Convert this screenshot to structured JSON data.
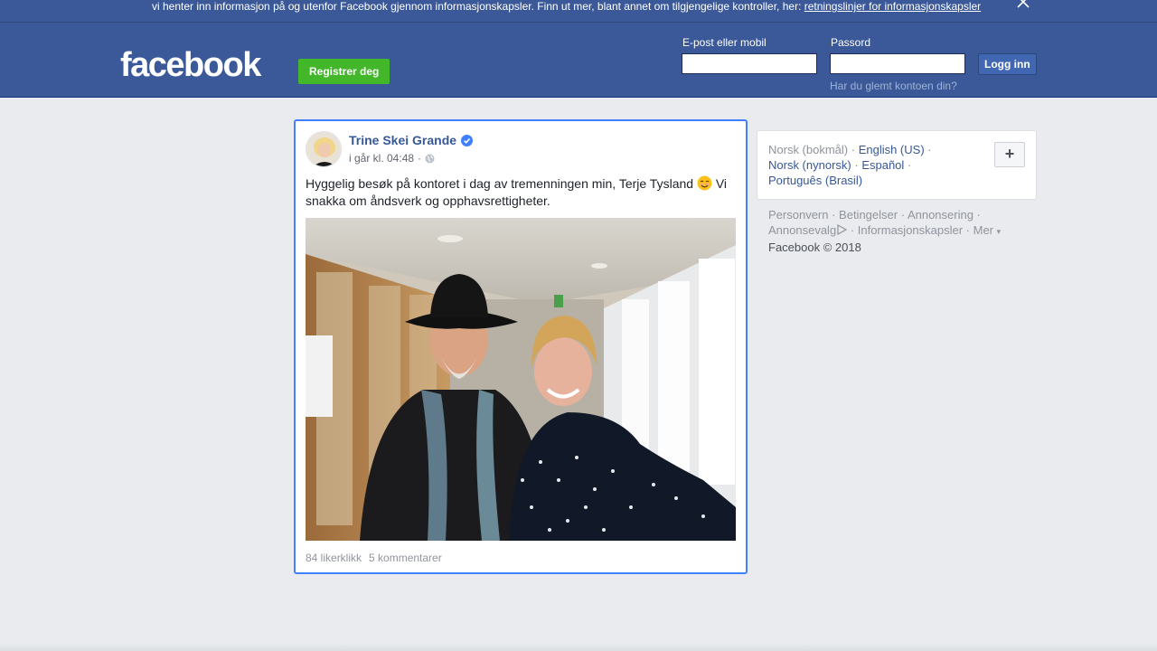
{
  "cookie_banner": {
    "text": "vi henter inn informasjon på og utenfor Facebook gjennom informasjonskapsler. Finn ut mer, blant annet om tilgjengelige kontroller, her: ",
    "link": "retningslinjer for informasjonskapsler",
    "close_icon": "close-icon"
  },
  "header": {
    "logo": "facebook",
    "register_label": "Registrer deg",
    "email_label": "E-post eller mobil",
    "email_value": "",
    "password_label": "Passord",
    "password_value": "",
    "login_label": "Logg inn",
    "forgot_label": "Har du glemt kontoen din?"
  },
  "post": {
    "author": "Trine Skei Grande",
    "verified_icon": "verified-badge-icon",
    "time": "i går kl. 04:48",
    "separator": "·",
    "privacy_icon": "globe-icon",
    "text_before_emoji": "Hyggelig besøk på kontoret i dag av tremenningen min, Terje Tysland ",
    "emoji_icon": "smiling-face-emoji-icon",
    "text_after_emoji": " Vi snakka om åndsverk og opphavsrettigheter.",
    "likes": "84 likerklikk",
    "comments": "5 kommentarer"
  },
  "languages": {
    "current": "Norsk (bokmål)",
    "options": [
      "English (US)",
      "Norsk (nynorsk)",
      "Español",
      "Português (Brasil)"
    ],
    "separator": " · ",
    "add_icon": "plus-icon",
    "add_label": "+"
  },
  "footer": {
    "links": [
      "Personvern",
      "Betingelser",
      "Annonsering",
      "Annonsevalg",
      "Informasjonskapsler",
      "Mer"
    ],
    "adchoices_icon": "adchoices-icon",
    "more_caret": "▾",
    "copyright": "Facebook © 2018"
  },
  "colors": {
    "brand": "#3b5998",
    "link": "#365899",
    "green": "#42b72a",
    "focus": "#4080ff"
  }
}
